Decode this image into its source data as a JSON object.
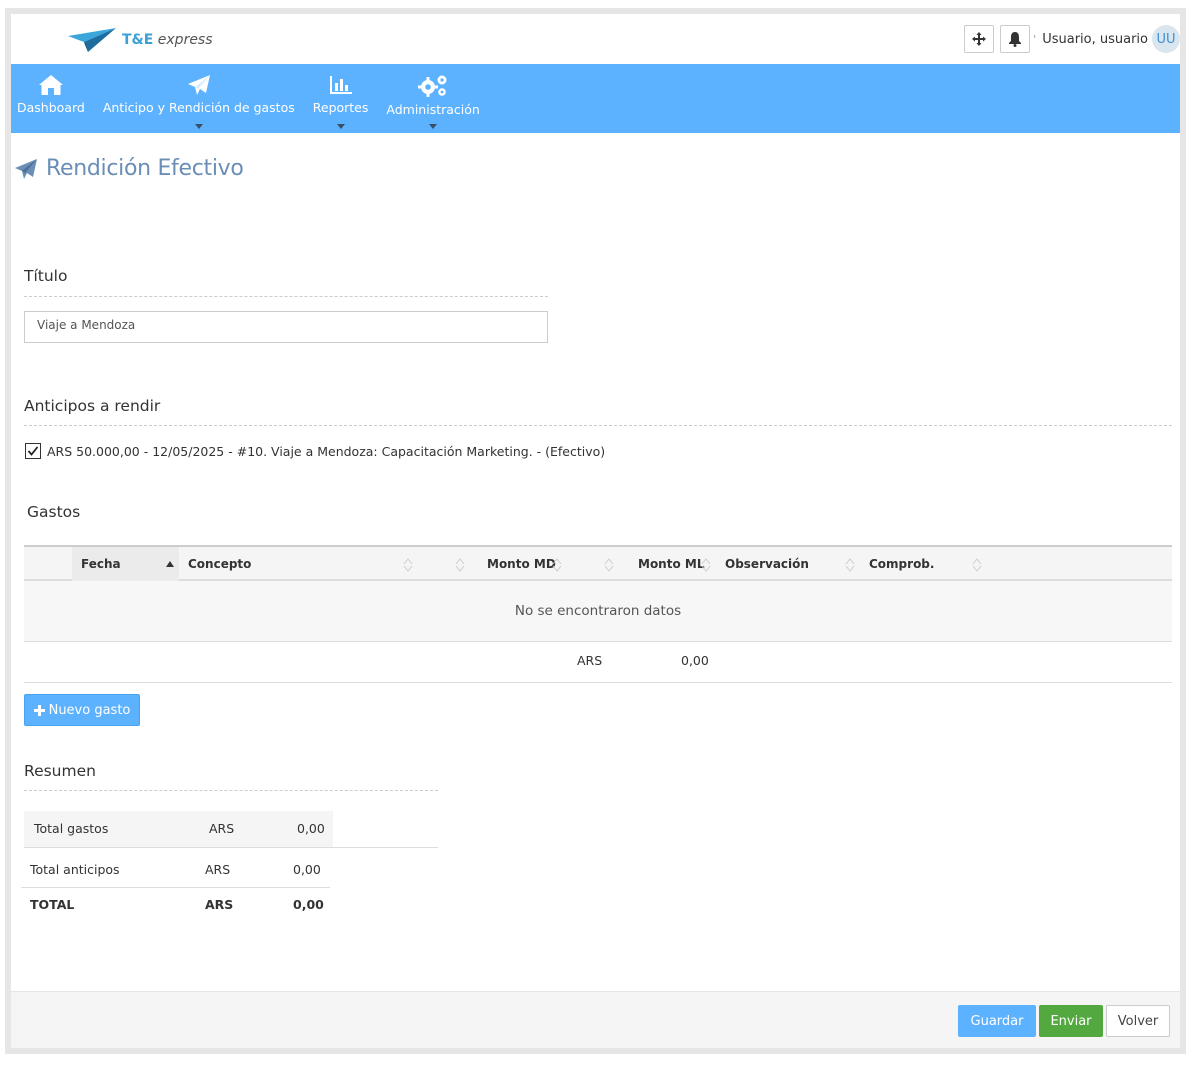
{
  "header": {
    "brand_prefix": "T&E",
    "brand_suffix": "express",
    "user_label": "Usuario, usuario",
    "avatar_initials": "UU"
  },
  "nav": {
    "items": [
      {
        "label": "Dashboard",
        "icon": "home-icon",
        "has_caret": false
      },
      {
        "label": "Anticipo y Rendición de gastos",
        "icon": "paper-plane-icon",
        "has_caret": true
      },
      {
        "label": "Reportes",
        "icon": "bar-chart-icon",
        "has_caret": true
      },
      {
        "label": "Administración",
        "icon": "gears-icon",
        "has_caret": true
      }
    ]
  },
  "page": {
    "title": "Rendición Efectivo"
  },
  "titulo": {
    "label": "Título",
    "value": "Viaje a Mendoza"
  },
  "anticipos": {
    "label": "Anticipos a rendir",
    "item_text": "ARS 50.000,00 - 12/05/2025 - #10. Viaje a Mendoza: Capacitación Marketing. - (Efectivo)",
    "checked": true
  },
  "gastos": {
    "label": "Gastos",
    "columns": [
      "Fecha",
      "Concepto",
      "Monto MD",
      "Monto ML",
      "Observación",
      "Comprob."
    ],
    "empty_message": "No se encontraron datos",
    "footer_currency": "ARS",
    "footer_total": "0,00",
    "new_button": "Nuevo gasto"
  },
  "resumen": {
    "label": "Resumen",
    "rows": [
      {
        "label": "Total gastos",
        "currency": "ARS",
        "amount": "0,00"
      },
      {
        "label": "Total anticipos",
        "currency": "ARS",
        "amount": "0,00"
      },
      {
        "label": "TOTAL",
        "currency": "ARS",
        "amount": "0,00"
      }
    ]
  },
  "actions": {
    "save": "Guardar",
    "send": "Enviar",
    "back": "Volver"
  },
  "colors": {
    "nav_bg": "#5db2ff",
    "title_color": "#6a8eb6",
    "send_green": "#53a93f"
  }
}
